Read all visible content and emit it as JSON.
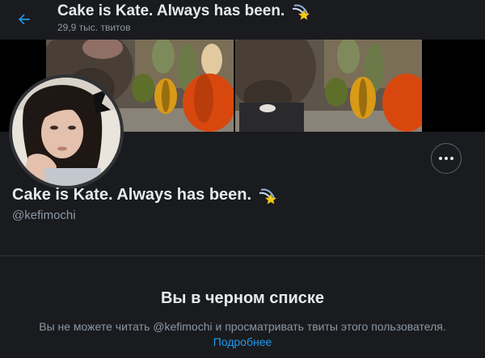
{
  "header": {
    "title": "Cake is Kate. Always has been.",
    "title_emoji": "shooting-star-icon",
    "tweet_count": "29,9 тыс. твитов",
    "back_icon": "arrow-left-icon"
  },
  "profile": {
    "display_name": "Cake is Kate. Always has been.",
    "name_emoji": "shooting-star-icon",
    "handle": "@kefimochi",
    "more_icon": "more-dots-icon"
  },
  "blocked": {
    "title": "Вы в черном списке",
    "message": "Вы не можете читать @kefimochi и просматривать твиты этого пользователя.",
    "link_label": "Подробнее"
  },
  "colors": {
    "accent": "#1d9bf0",
    "background": "#1a1b1e",
    "secondary_text": "#8b98a5"
  }
}
